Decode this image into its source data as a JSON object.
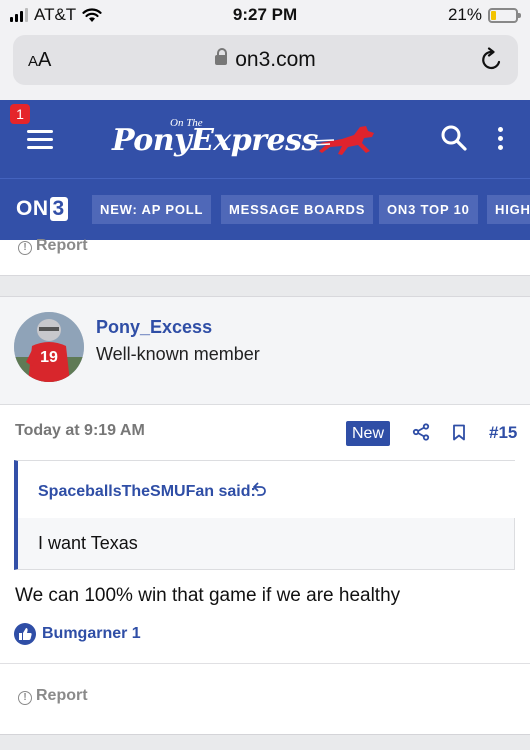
{
  "status_bar": {
    "carrier": "AT&T",
    "time": "9:27 PM",
    "battery_percent": "21%",
    "battery_level": 0.21,
    "icons": [
      "cellular-signal-icon",
      "wifi-icon",
      "battery-icon"
    ]
  },
  "browser": {
    "text_size_label_small": "A",
    "text_size_label_large": "A",
    "url": "on3.com",
    "icons": [
      "lock-icon",
      "reload-icon"
    ]
  },
  "site_header": {
    "notification_count": "1",
    "logo_small_text": "On The",
    "logo_main_text": "PonyExpress",
    "icons": [
      "menu-icon",
      "search-icon",
      "more-vertical-icon",
      "horse-rider-icon"
    ]
  },
  "nav": {
    "brand_on": "ON",
    "brand_three": "3",
    "items": [
      "NEW: AP POLL",
      "MESSAGE BOARDS",
      "ON3 TOP 10",
      "HIGH"
    ]
  },
  "previous_post": {
    "report_label": "Report"
  },
  "post": {
    "username": "Pony_Excess",
    "user_title": "Well-known member",
    "avatar_jersey_number": "19",
    "date": "Today at 9:19 AM",
    "new_badge": "New",
    "post_number": "#15",
    "quote": {
      "author": "SpaceballsTheSMUFan said:",
      "text": "I want Texas"
    },
    "body": "We can 100% win that game if we are healthy",
    "reaction_text": "Bumgarner 1",
    "report_label": "Report",
    "accent_color": "#3350a8",
    "link_color": "#2f4ea6"
  }
}
